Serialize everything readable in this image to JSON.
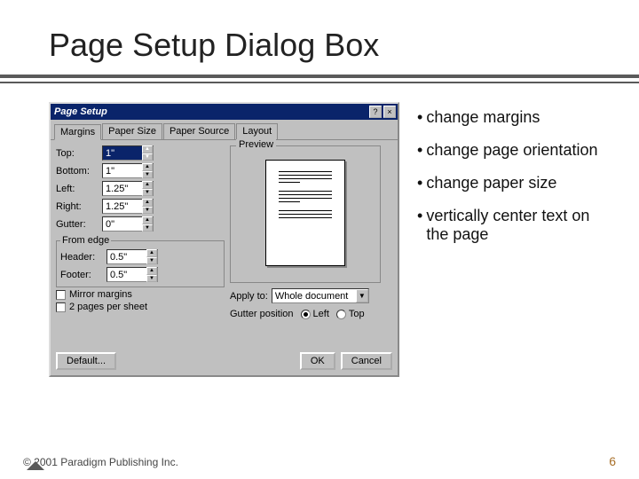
{
  "title": "Page Setup Dialog Box",
  "dialog": {
    "caption": "Page Setup",
    "tabs": [
      "Margins",
      "Paper Size",
      "Paper Source",
      "Layout"
    ],
    "margins": {
      "top_label": "Top:",
      "top": "1\"",
      "bottom_label": "Bottom:",
      "bottom": "1\"",
      "left_label": "Left:",
      "left": "1.25\"",
      "right_label": "Right:",
      "right": "1.25\"",
      "gutter_label": "Gutter:",
      "gutter": "0\""
    },
    "from_edge": {
      "legend": "From edge",
      "header_label": "Header:",
      "header": "0.5\"",
      "footer_label": "Footer:",
      "footer": "0.5\""
    },
    "checks": {
      "mirror": "Mirror margins",
      "two_pages": "2 pages per sheet"
    },
    "preview_label": "Preview",
    "apply_to_label": "Apply to:",
    "apply_to_value": "Whole document",
    "gutter_pos_label": "Gutter position",
    "gutter_left": "Left",
    "gutter_top": "Top",
    "buttons": {
      "default": "Default...",
      "ok": "OK",
      "cancel": "Cancel"
    }
  },
  "bullets": [
    "change margins",
    "change page orientation",
    "change paper size",
    "vertically center text on the page"
  ],
  "footer": "© 2001 Paradigm Publishing Inc.",
  "page_number": "6"
}
